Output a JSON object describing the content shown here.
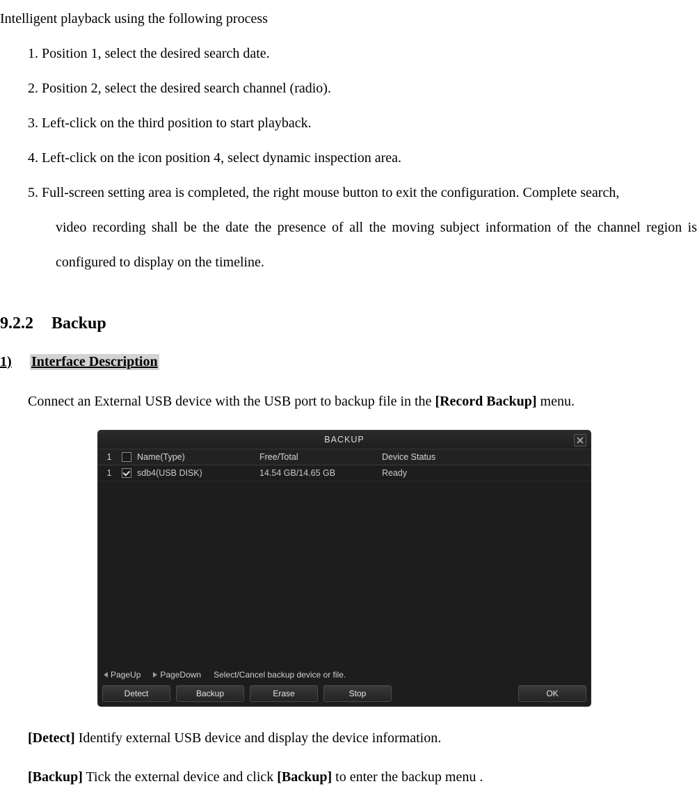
{
  "intro": "Intelligent playback using the following process",
  "steps": {
    "s1": "1. Position 1, select the desired search date.",
    "s2": "2. Position 2, select the desired search channel (radio).",
    "s3": "3. Left-click on the third position to start playback.",
    "s4": "4. Left-click on the icon position 4, select dynamic inspection area.",
    "s5a": "5. Full-screen setting area is completed, the right mouse button to exit the configuration. Complete search,",
    "s5b": "video recording shall be the date the presence of all the moving subject information of the channel region is configured to display on the timeline."
  },
  "section": {
    "num": "9.2.2",
    "title": "Backup"
  },
  "subhead": {
    "num": "1)",
    "title": "Interface Description"
  },
  "p1": {
    "pre": "Connect an External USB device with the USB port to backup file in the ",
    "bold": "[Record Backup]",
    "post": " menu."
  },
  "dialog": {
    "title": "BACKUP",
    "columns": {
      "idx": "1",
      "name": "Name(Type)",
      "free": "Free/Total",
      "status": "Device Status"
    },
    "rows": [
      {
        "idx": "1",
        "checked": true,
        "name": "sdb4(USB DISK)",
        "free": "14.54 GB/14.65 GB",
        "status": "Ready"
      }
    ],
    "hint": {
      "pageup": "PageUp",
      "pagedown": "PageDown",
      "tip": "Select/Cancel backup device or file."
    },
    "buttons": {
      "detect": "Detect",
      "backup": "Backup",
      "erase": "Erase",
      "stop": "Stop",
      "ok": "OK"
    }
  },
  "p2": {
    "bold": "[Detect]",
    "rest": " Identify external USB device and display the device information."
  },
  "p3": {
    "bold1": "[Backup]",
    "mid": " Tick the external device and click ",
    "bold2": "[Backup]",
    "rest": " to enter the backup menu ."
  }
}
